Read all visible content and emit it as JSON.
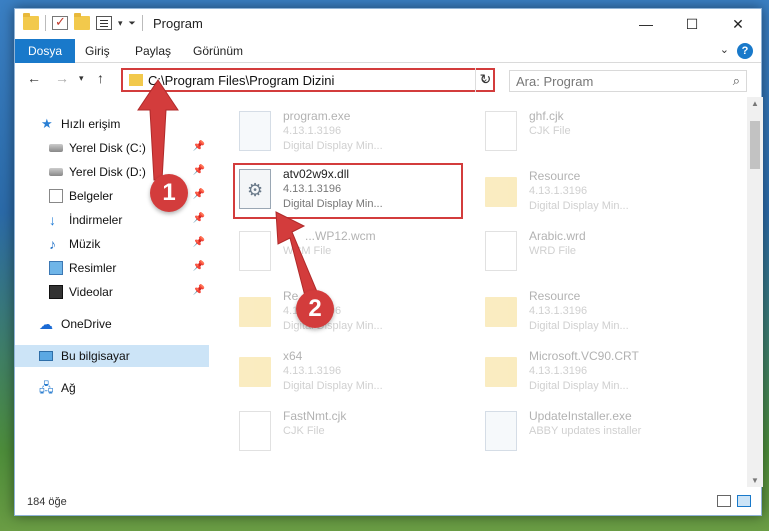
{
  "window": {
    "title": "Program"
  },
  "ribbon": {
    "tabs": [
      "Dosya",
      "Giriş",
      "Paylaş",
      "Görünüm"
    ]
  },
  "address": {
    "path": "C:\\Program Files\\Program Dizini"
  },
  "search": {
    "placeholder": "Ara: Program"
  },
  "sidebar": {
    "items": [
      {
        "label": "Hızlı erişim",
        "icon": "star-icon"
      },
      {
        "label": "Yerel Disk (C:)",
        "icon": "disk-icon"
      },
      {
        "label": "Yerel Disk (D:)",
        "icon": "disk-icon"
      },
      {
        "label": "Belgeler",
        "icon": "documents-icon"
      },
      {
        "label": "İndirmeler",
        "icon": "download-icon"
      },
      {
        "label": "Müzik",
        "icon": "music-icon"
      },
      {
        "label": "Resimler",
        "icon": "pictures-icon"
      },
      {
        "label": "Videolar",
        "icon": "video-icon"
      },
      {
        "label": "OneDrive",
        "icon": "cloud-icon"
      },
      {
        "label": "Bu bilgisayar",
        "icon": "computer-icon"
      },
      {
        "label": "Ağ",
        "icon": "network-icon"
      }
    ]
  },
  "files": [
    {
      "name": "program.exe",
      "meta1": "4.13.1.3196",
      "meta2": "Digital Display Min...",
      "type": "exe"
    },
    {
      "name": "ghf.cjk",
      "meta1": "CJK File",
      "meta2": "",
      "type": "page"
    },
    {
      "name": "atv02w9x.dll",
      "meta1": "4.13.1.3196",
      "meta2": "Digital Display Min...",
      "type": "dll"
    },
    {
      "name": "Resource",
      "meta1": "4.13.1.3196",
      "meta2": "Digital Display Min...",
      "type": "folder"
    },
    {
      "name": "...WP12.wcm",
      "meta1": "WCM File",
      "meta2": "",
      "type": "page"
    },
    {
      "name": "Arabic.wrd",
      "meta1": "WRD File",
      "meta2": "",
      "type": "page"
    },
    {
      "name": "Re...",
      "meta1": "4.13.1.3196",
      "meta2": "Digital Display Min...",
      "type": "folder"
    },
    {
      "name": "Resource",
      "meta1": "4.13.1.3196",
      "meta2": "Digital Display Min...",
      "type": "folder"
    },
    {
      "name": "x64",
      "meta1": "4.13.1.3196",
      "meta2": "Digital Display Min...",
      "type": "folder"
    },
    {
      "name": "Microsoft.VC90.CRT",
      "meta1": "4.13.1.3196",
      "meta2": "Digital Display Min...",
      "type": "folder"
    },
    {
      "name": "FastNmt.cjk",
      "meta1": "CJK File",
      "meta2": "",
      "type": "page"
    },
    {
      "name": "UpdateInstaller.exe",
      "meta1": "ABBY updates installer",
      "meta2": "",
      "type": "exe"
    }
  ],
  "status": {
    "count": "184 öğe"
  },
  "callouts": [
    "1",
    "2"
  ],
  "colors": {
    "accent": "#1979ca",
    "highlight": "#d33c3c"
  }
}
